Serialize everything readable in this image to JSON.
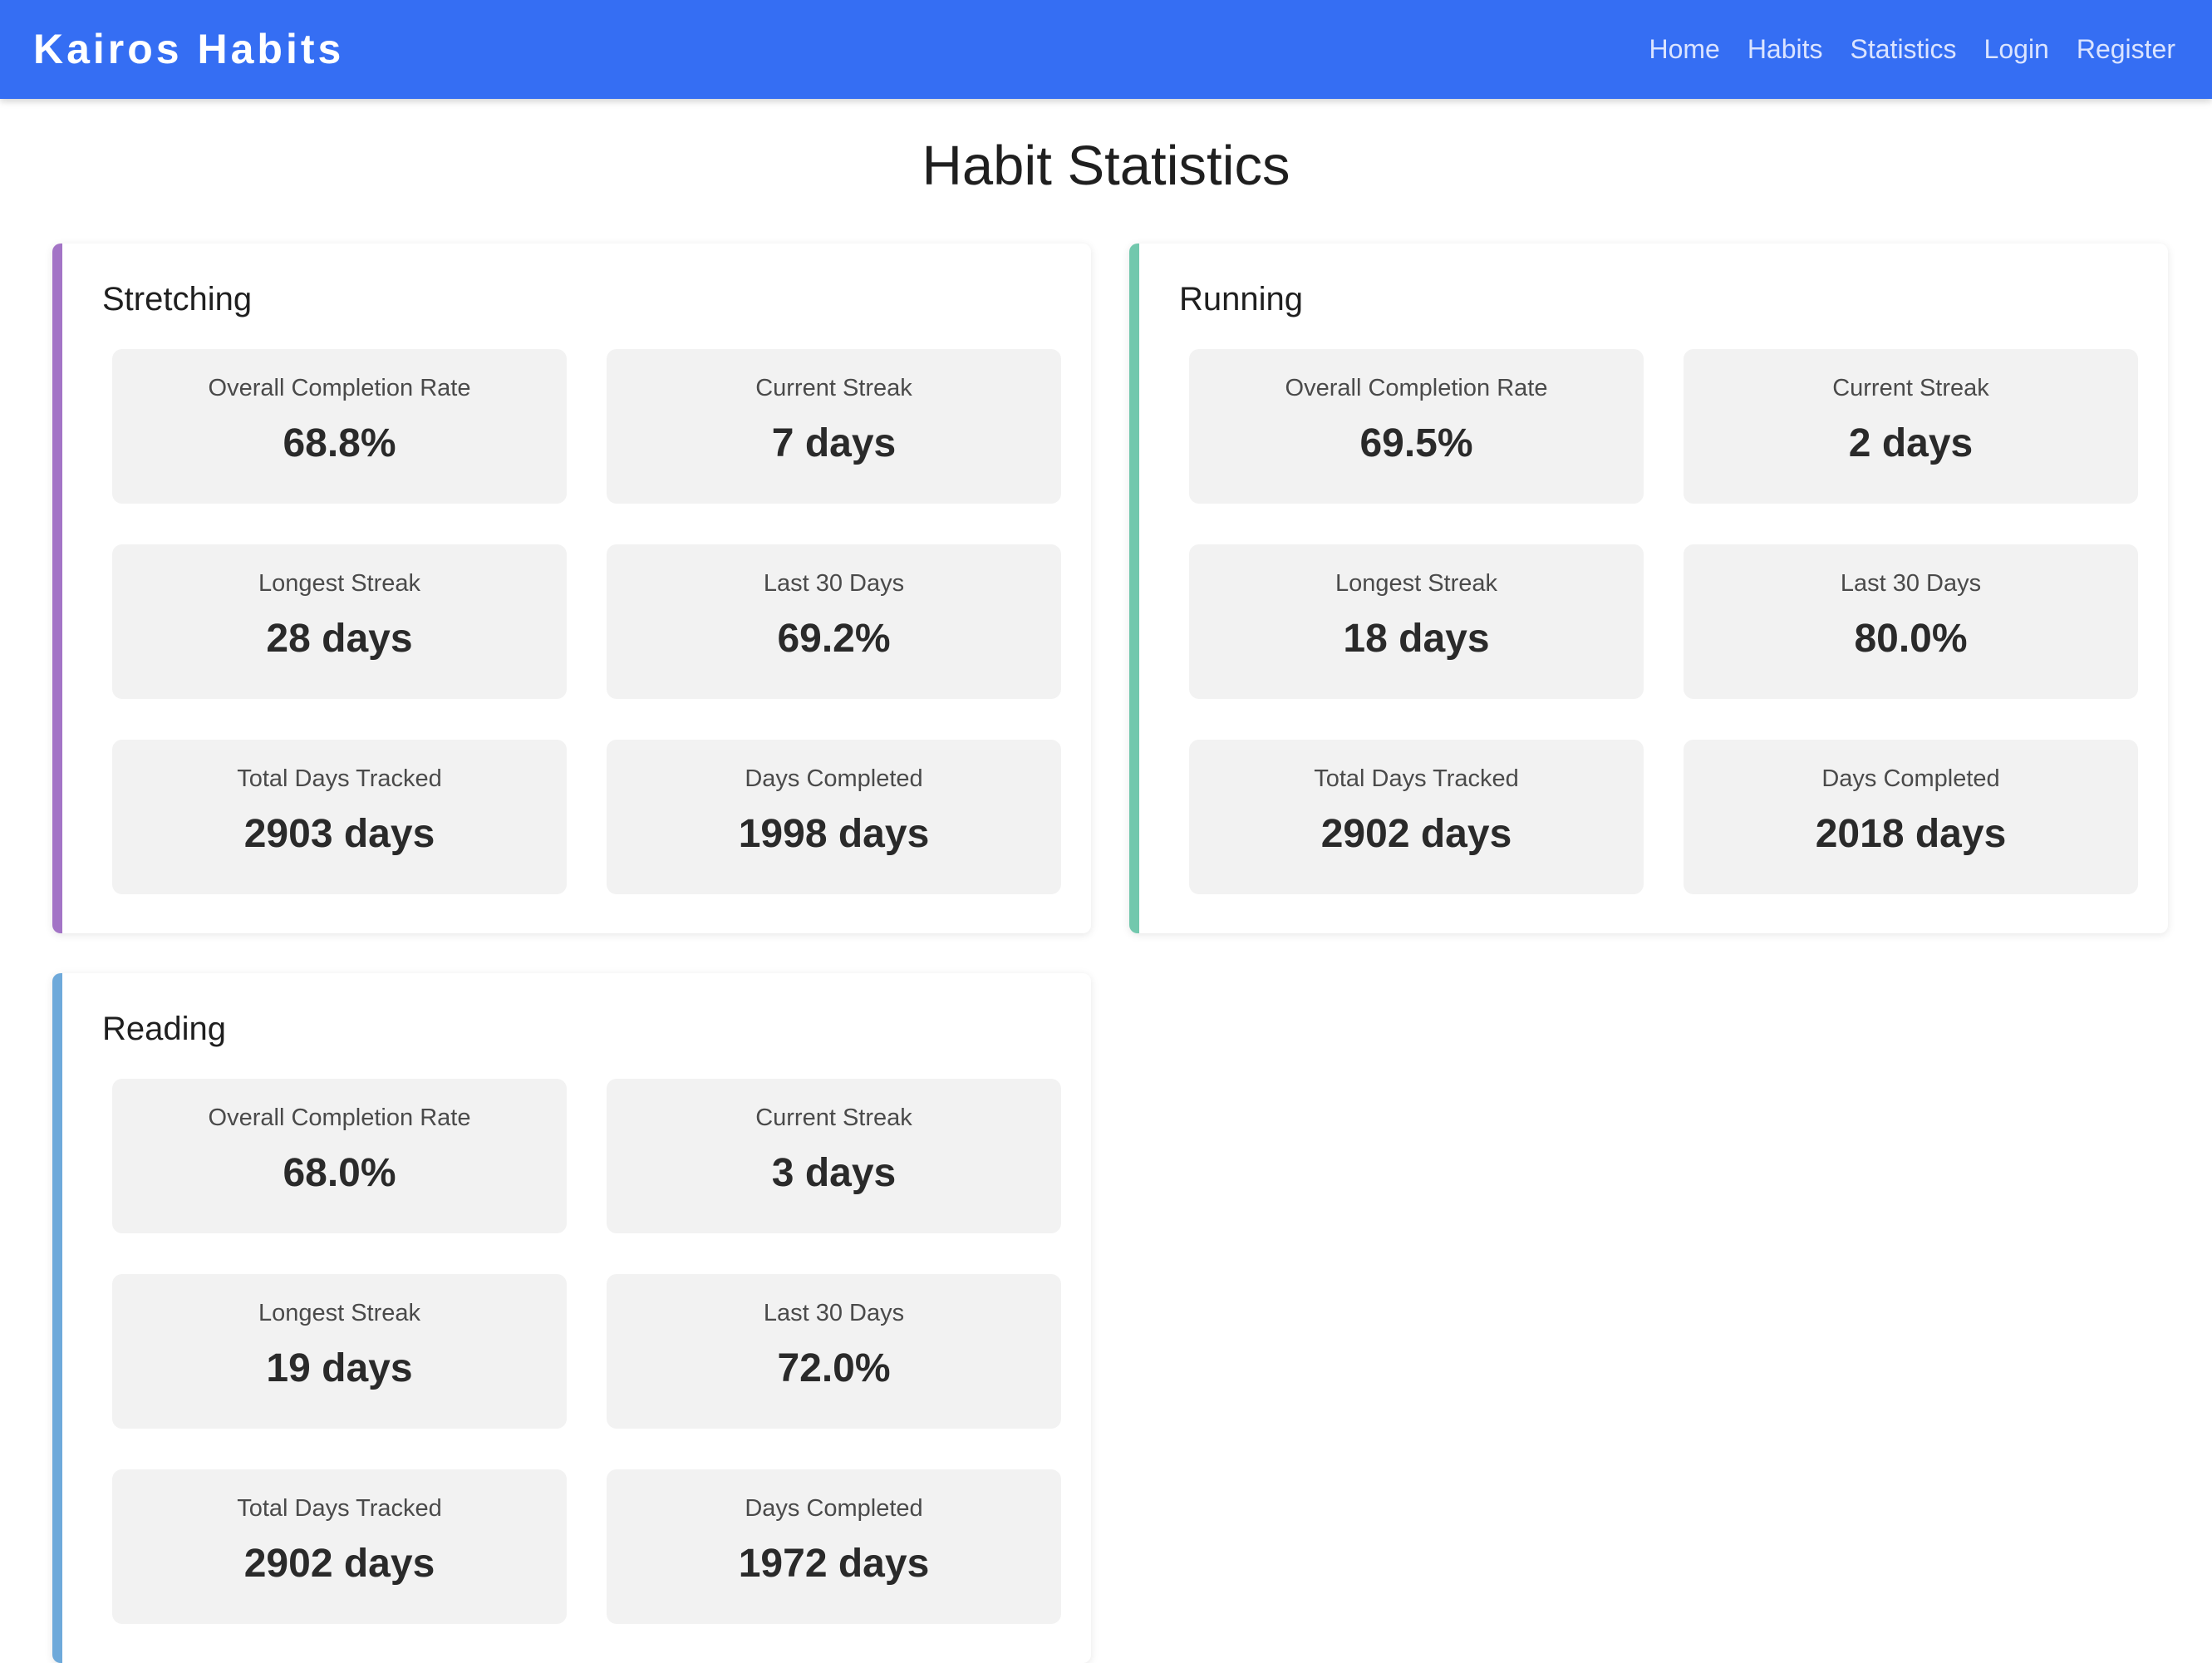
{
  "navbar": {
    "brand": "Kairos Habits",
    "links": [
      "Home",
      "Habits",
      "Statistics",
      "Login",
      "Register"
    ]
  },
  "page": {
    "title": "Habit Statistics"
  },
  "habits": [
    {
      "name": "Stretching",
      "color": "#a374c6",
      "stats": [
        {
          "label": "Overall Completion Rate",
          "value": "68.8%"
        },
        {
          "label": "Current Streak",
          "value": "7 days"
        },
        {
          "label": "Longest Streak",
          "value": "28 days"
        },
        {
          "label": "Last 30 Days",
          "value": "69.2%"
        },
        {
          "label": "Total Days Tracked",
          "value": "2903 days"
        },
        {
          "label": "Days Completed",
          "value": "1998 days"
        }
      ]
    },
    {
      "name": "Running",
      "color": "#72c8ad",
      "stats": [
        {
          "label": "Overall Completion Rate",
          "value": "69.5%"
        },
        {
          "label": "Current Streak",
          "value": "2 days"
        },
        {
          "label": "Longest Streak",
          "value": "18 days"
        },
        {
          "label": "Last 30 Days",
          "value": "80.0%"
        },
        {
          "label": "Total Days Tracked",
          "value": "2902 days"
        },
        {
          "label": "Days Completed",
          "value": "2018 days"
        }
      ]
    },
    {
      "name": "Reading",
      "color": "#6ea9da",
      "stats": [
        {
          "label": "Overall Completion Rate",
          "value": "68.0%"
        },
        {
          "label": "Current Streak",
          "value": "3 days"
        },
        {
          "label": "Longest Streak",
          "value": "19 days"
        },
        {
          "label": "Last 30 Days",
          "value": "72.0%"
        },
        {
          "label": "Total Days Tracked",
          "value": "2902 days"
        },
        {
          "label": "Days Completed",
          "value": "1972 days"
        }
      ]
    }
  ]
}
